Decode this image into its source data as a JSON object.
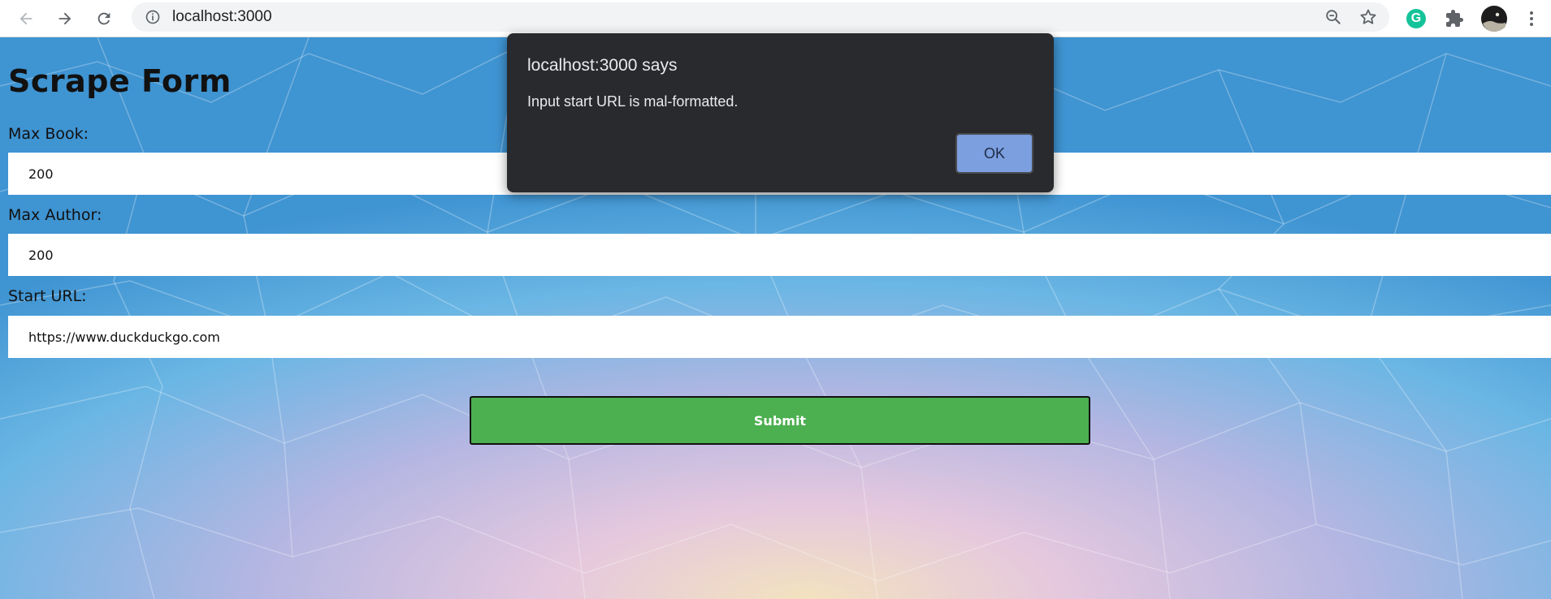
{
  "browser": {
    "address": "localhost:3000",
    "icons": {
      "back": "arrow-back-icon",
      "forward": "arrow-forward-icon",
      "reload": "reload-icon",
      "info": "info-icon",
      "zoom": "zoom-out-icon",
      "bookmark": "star-icon",
      "grammarly": "grammarly-icon",
      "extensions": "puzzle-icon",
      "profile": "avatar",
      "menu": "kebab-menu-icon"
    },
    "grammarly_letter": "G"
  },
  "form": {
    "title": "Scrape Form",
    "max_book_label": "Max Book:",
    "max_book_value": "200",
    "max_author_label": "Max Author:",
    "max_author_value": "200",
    "start_url_label": "Start URL:",
    "start_url_value": "https://www.duckduckgo.com",
    "submit_label": "Submit"
  },
  "alert": {
    "title": "localhost:3000 says",
    "message": "Input start URL is mal-formatted.",
    "ok_label": "OK"
  },
  "colors": {
    "submit": "#4caf50",
    "dialog": "#292a2d",
    "ok_button": "#7b9fdf",
    "grammarly": "#15c39a"
  }
}
